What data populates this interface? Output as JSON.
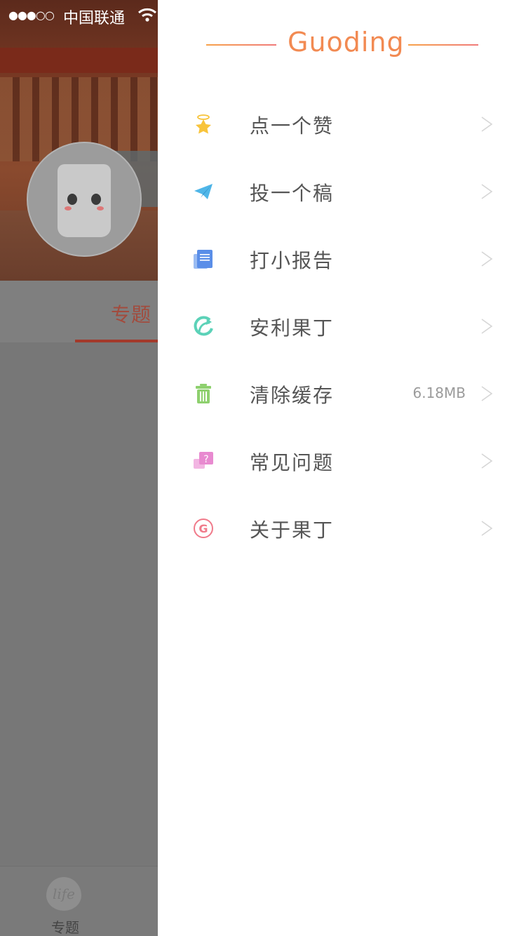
{
  "status_bar": {
    "signal": "●●●○○",
    "carrier": "中国联通"
  },
  "background_app": {
    "tab_label": "专题",
    "bottom_nav_icon_text": "life",
    "bottom_nav_label": "专题"
  },
  "drawer": {
    "brand": "Guoding",
    "items": [
      {
        "label": "点一个赞",
        "icon": "star-icon",
        "color": "#f8c43c"
      },
      {
        "label": "投一个稿",
        "icon": "paper-plane-icon",
        "color": "#4fb6e8"
      },
      {
        "label": "打小报告",
        "icon": "notebook-icon",
        "color": "#5a8ee8"
      },
      {
        "label": "安利果丁",
        "icon": "share-arrow-icon",
        "color": "#5cd2b8"
      },
      {
        "label": "清除缓存",
        "icon": "trash-icon",
        "color": "#8ed06e",
        "value": "6.18MB"
      },
      {
        "label": "常见问题",
        "icon": "question-chat-icon",
        "color": "#e88ad0"
      },
      {
        "label": "关于果丁",
        "icon": "g-logo-icon",
        "color": "#f07a8a"
      }
    ]
  }
}
